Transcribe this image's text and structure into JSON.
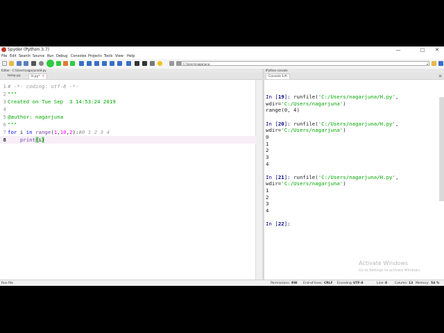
{
  "window": {
    "title": "Spyder (Python 3.7)",
    "minimize": "—",
    "maximize": "□",
    "close": "✕"
  },
  "menu": [
    "File",
    "Edit",
    "Search",
    "Source",
    "Run",
    "Debug",
    "Consoles",
    "Projects",
    "Tools",
    "View",
    "Help"
  ],
  "toolbar": {
    "path": "C:\\Users\\nagarjuna",
    "dropdown": "▾"
  },
  "editor": {
    "header": "Editor - C:\\Users\\nagarjuna\\H.py",
    "tabs": [
      {
        "label": "temp.py",
        "close": ""
      },
      {
        "label": "H.py*",
        "close": "✕"
      }
    ],
    "lines": [
      {
        "n": "1",
        "parts": [
          {
            "t": "# -*- coding: utf-8 -*-",
            "c": "c-com"
          }
        ]
      },
      {
        "n": "2",
        "parts": [
          {
            "t": "\"\"\"",
            "c": "c-str"
          }
        ]
      },
      {
        "n": "3",
        "parts": [
          {
            "t": "Created on Tue Sep  3 14:53:24 2019",
            "c": "c-str"
          }
        ]
      },
      {
        "n": "4",
        "parts": [
          {
            "t": "",
            "c": "c-str"
          }
        ]
      },
      {
        "n": "5",
        "parts": [
          {
            "t": "@author: nagarjuna",
            "c": "c-str"
          }
        ]
      },
      {
        "n": "6",
        "parts": [
          {
            "t": "\"\"\"",
            "c": "c-str"
          }
        ]
      },
      {
        "n": "7",
        "parts": [
          {
            "t": "for",
            "c": "c-kw"
          },
          {
            "t": " i ",
            "c": "c-plain"
          },
          {
            "t": "in",
            "c": "c-kw"
          },
          {
            "t": " ",
            "c": "c-plain"
          },
          {
            "t": "range",
            "c": "c-fn"
          },
          {
            "t": "(",
            "c": "c-plain"
          },
          {
            "t": "1",
            "c": "c-num"
          },
          {
            "t": ",",
            "c": "c-plain"
          },
          {
            "t": "10",
            "c": "c-num"
          },
          {
            "t": ",",
            "c": "c-plain"
          },
          {
            "t": "2",
            "c": "c-num"
          },
          {
            "t": "):",
            "c": "c-plain"
          },
          {
            "t": "#0 1 2 3 4",
            "c": "c-com"
          }
        ]
      },
      {
        "n": "8",
        "parts": [
          {
            "t": "    ",
            "c": "c-plain"
          },
          {
            "t": "print",
            "c": "c-fn"
          },
          {
            "t": "(",
            "c": "c-plain hl"
          },
          {
            "t": "i",
            "c": "c-plain"
          },
          {
            "t": ")",
            "c": "c-plain hl"
          }
        ]
      }
    ]
  },
  "console": {
    "header": "IPython console",
    "tab": "Console 1/A",
    "menu_icon": "≡",
    "lines": [
      {
        "parts": [
          {
            "t": "In [",
            "c": "p"
          },
          {
            "t": "19",
            "c": "pn"
          },
          {
            "t": "]: ",
            "c": "p"
          },
          {
            "t": "runfile(",
            "c": ""
          },
          {
            "t": "'C:/Users/nagarjuna/H.py'",
            "c": "s"
          },
          {
            "t": ",",
            "c": ""
          }
        ]
      },
      {
        "parts": [
          {
            "t": "wdir=",
            "c": ""
          },
          {
            "t": "'C:/Users/nagarjuna'",
            "c": "s"
          },
          {
            "t": ")",
            "c": ""
          }
        ]
      },
      {
        "parts": [
          {
            "t": "range(0, 4)",
            "c": ""
          }
        ]
      },
      {
        "parts": [
          {
            "t": "",
            "c": ""
          }
        ]
      },
      {
        "parts": [
          {
            "t": "In [",
            "c": "p"
          },
          {
            "t": "20",
            "c": "pn"
          },
          {
            "t": "]: ",
            "c": "p"
          },
          {
            "t": "runfile(",
            "c": ""
          },
          {
            "t": "'C:/Users/nagarjuna/H.py'",
            "c": "s"
          },
          {
            "t": ",",
            "c": ""
          }
        ]
      },
      {
        "parts": [
          {
            "t": "wdir=",
            "c": ""
          },
          {
            "t": "'C:/Users/nagarjuna'",
            "c": "s"
          },
          {
            "t": ")",
            "c": ""
          }
        ]
      },
      {
        "parts": [
          {
            "t": "0",
            "c": ""
          }
        ]
      },
      {
        "parts": [
          {
            "t": "1",
            "c": ""
          }
        ]
      },
      {
        "parts": [
          {
            "t": "2",
            "c": ""
          }
        ]
      },
      {
        "parts": [
          {
            "t": "3",
            "c": ""
          }
        ]
      },
      {
        "parts": [
          {
            "t": "4",
            "c": ""
          }
        ]
      },
      {
        "parts": [
          {
            "t": "",
            "c": ""
          }
        ]
      },
      {
        "parts": [
          {
            "t": "In [",
            "c": "p"
          },
          {
            "t": "21",
            "c": "pn"
          },
          {
            "t": "]: ",
            "c": "p"
          },
          {
            "t": "runfile(",
            "c": ""
          },
          {
            "t": "'C:/Users/nagarjuna/H.py'",
            "c": "s"
          },
          {
            "t": ",",
            "c": ""
          }
        ]
      },
      {
        "parts": [
          {
            "t": "wdir=",
            "c": ""
          },
          {
            "t": "'C:/Users/nagarjuna'",
            "c": "s"
          },
          {
            "t": ")",
            "c": ""
          }
        ]
      },
      {
        "parts": [
          {
            "t": "1",
            "c": ""
          }
        ]
      },
      {
        "parts": [
          {
            "t": "2",
            "c": ""
          }
        ]
      },
      {
        "parts": [
          {
            "t": "3",
            "c": ""
          }
        ]
      },
      {
        "parts": [
          {
            "t": "4",
            "c": ""
          }
        ]
      },
      {
        "parts": [
          {
            "t": "",
            "c": ""
          }
        ]
      },
      {
        "parts": [
          {
            "t": "In [",
            "c": "p"
          },
          {
            "t": "22",
            "c": "pn"
          },
          {
            "t": "]: ",
            "c": "p"
          }
        ]
      }
    ],
    "watermark": "Activate Windows",
    "watermark_sub": "Go to Settings to activate Windows."
  },
  "status": {
    "left": "Run file",
    "permissions_label": "Permissions:",
    "permissions": "RW",
    "eol_label": "End-of-lines:",
    "eol": "CRLF",
    "encoding_label": "Encoding:",
    "encoding": "UTF-8",
    "line_label": "Line:",
    "line": "8",
    "column_label": "Column:",
    "column": "13",
    "memory_label": "Memory:",
    "memory": "54 %"
  },
  "colors": {
    "run_green": "#2ecc40",
    "prompt_blue": "#000080",
    "string_green": "#00aa00"
  }
}
